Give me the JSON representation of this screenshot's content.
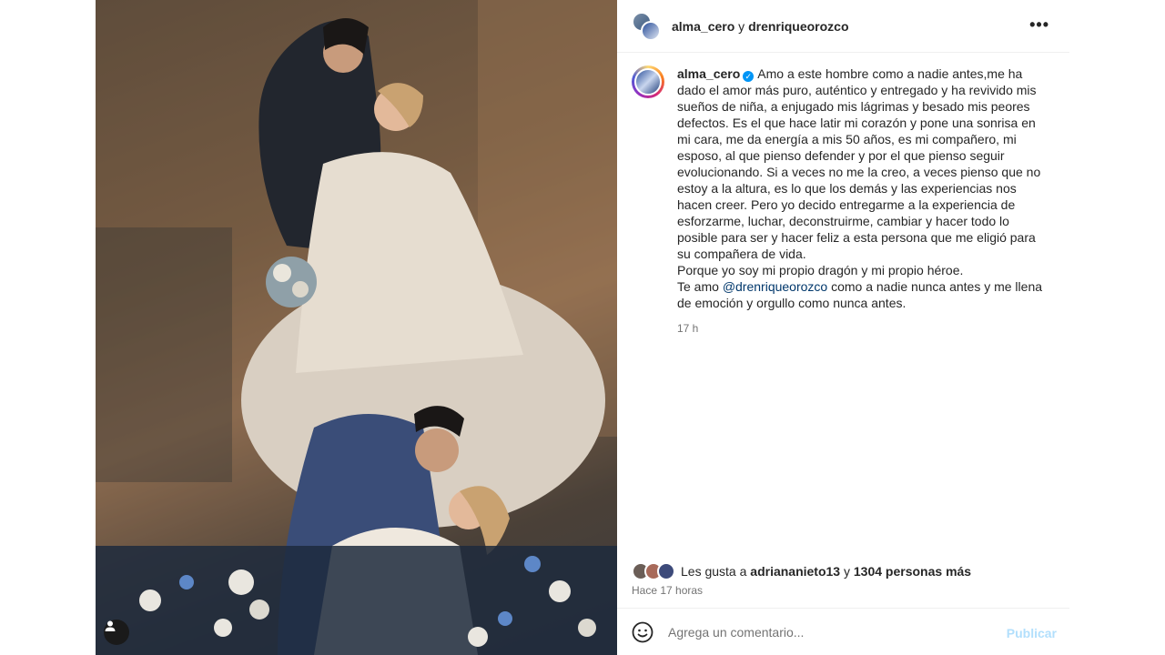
{
  "photo": {
    "alt": "",
    "tag_icon": "user-tag-icon"
  },
  "header": {
    "user1": "alma_cero",
    "conjunction": "y",
    "user2": "drenriqueorozco",
    "more_icon": "more-horizontal-icon",
    "more_label": "•••"
  },
  "caption": {
    "username": "alma_cero",
    "verified_icon": "verified-badge-icon",
    "text_1": "Amo a este hombre como a nadie antes,me ha dado el amor más puro, auténtico y entregado y ha revivido mis sueños de niña, a enjugado mis lágrimas y besado mis peores defectos. Es el que hace latir mi corazón y pone una sonrisa en mi cara, me da energía a mis 50 años, es mi compañero, mi esposo, al que pienso defender y por el que pienso seguir evolucionando. Si a veces no me la creo, a veces pienso que no estoy a la altura, es lo que los demás y las experiencias nos hacen creer. Pero yo decido entregarme a la experiencia de esforzarme, luchar, deconstruirme, cambiar y hacer todo lo posible para ser y hacer feliz a esta persona que me eligió para su compañera de vida.",
    "text_2": "Porque yo soy mi propio dragón y mi propio héroe.",
    "text_3_pre": "Te amo ",
    "mention": "@drenriqueorozco",
    "text_3_post": " como a nadie nunca antes y me llena de emoción y orgullo como nunca antes.",
    "time": "17 h"
  },
  "likes": {
    "prefix": "Les gusta a ",
    "user": "adriananieto13",
    "middle": " y ",
    "others": "1304 personas más"
  },
  "time_ago": "Hace 17 horas",
  "comment": {
    "emoji_icon": "emoji-smile-icon",
    "placeholder": "Agrega un comentario...",
    "publish_label": "Publicar"
  },
  "colors": {
    "link": "#00376b",
    "verified": "#0095f6",
    "publish_disabled": "#b2dffc",
    "secondary_text": "#737373"
  }
}
